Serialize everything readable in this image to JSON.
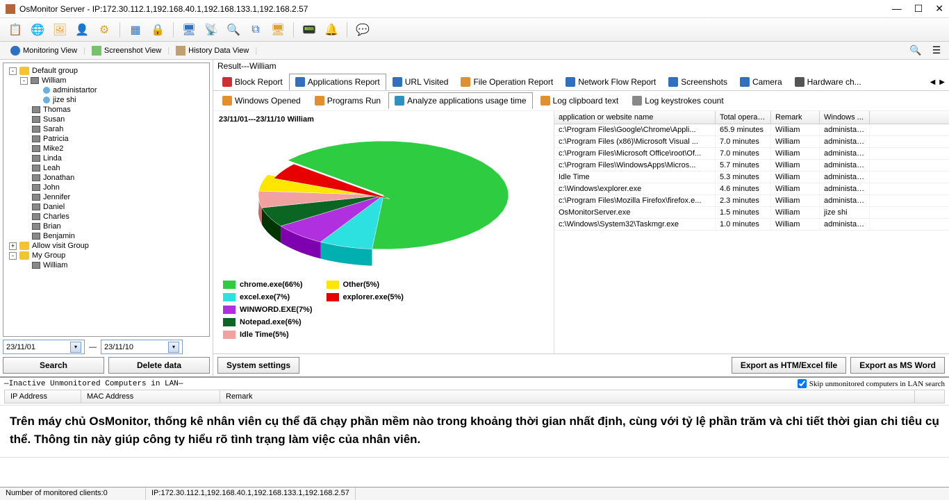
{
  "titlebar": {
    "text": "OsMonitor Server -   IP:172.30.112.1,192.168.40.1,192.168.133.1,192.168.2.57"
  },
  "viewbar": {
    "monitoring": "Monitoring View",
    "screenshot": "Screenshot View",
    "history": "History Data View"
  },
  "tree": {
    "default_group": "Default group",
    "items": [
      "William",
      "Thomas",
      "Susan",
      "Sarah",
      "Patricia",
      "Mike2",
      "Linda",
      "Leah",
      "Jonathan",
      "John",
      "Jennifer",
      "Daniel",
      "Charles",
      "Brian",
      "Benjamin"
    ],
    "william_children": [
      "administartor",
      "jize shi"
    ],
    "allow_group": "Allow visit Group",
    "my_group": "My Group",
    "my_group_children": [
      "William"
    ]
  },
  "dates": {
    "from": "23/11/01",
    "to": "23/11/10",
    "sep": "—"
  },
  "buttons": {
    "search": "Search",
    "delete": "Delete data",
    "system_settings": "System settings",
    "export_htm": "Export as HTM/Excel file",
    "export_word": "Export as MS Word"
  },
  "result_title": "Result---William",
  "report_tabs": [
    "Block Report",
    "Applications Report",
    "URL Visited",
    "File Operation Report",
    "Network Flow Report",
    "Screenshots",
    "Camera",
    "Hardware ch..."
  ],
  "sub_tabs": [
    "Windows Opened",
    "Programs Run",
    "Analyze applications usage time",
    "Log clipboard text",
    "Log keystrokes count"
  ],
  "chart_title": "23/11/01---23/11/10  William",
  "chart_data": {
    "type": "pie",
    "title": "23/11/01---23/11/10  William",
    "series": [
      {
        "name": "chrome.exe",
        "value": 66,
        "color": "#2ECC40"
      },
      {
        "name": "excel.exe",
        "value": 7,
        "color": "#2DE1E1"
      },
      {
        "name": "WINWORD.EXE",
        "value": 7,
        "color": "#B030E0"
      },
      {
        "name": "Notepad.exe",
        "value": 6,
        "color": "#0B6623"
      },
      {
        "name": "Idle Time",
        "value": 5,
        "color": "#F2A1A1"
      },
      {
        "name": "Other",
        "value": 5,
        "color": "#FFE600"
      },
      {
        "name": "explorer.exe",
        "value": 5,
        "color": "#E60000"
      }
    ]
  },
  "legend1": [
    {
      "label": "chrome.exe(66%)",
      "color": "#2ECC40"
    },
    {
      "label": "excel.exe(7%)",
      "color": "#2DE1E1"
    },
    {
      "label": "WINWORD.EXE(7%)",
      "color": "#B030E0"
    },
    {
      "label": "Notepad.exe(6%)",
      "color": "#0B6623"
    },
    {
      "label": "Idle Time(5%)",
      "color": "#F2A1A1"
    }
  ],
  "legend2": [
    {
      "label": "Other(5%)",
      "color": "#FFE600"
    },
    {
      "label": "explorer.exe(5%)",
      "color": "#E60000"
    }
  ],
  "table": {
    "headers": [
      "application or website name",
      "Total operati...",
      "Remark",
      "Windows ..."
    ],
    "rows": [
      [
        "c:\\Program Files\\Google\\Chrome\\Appli...",
        "65.9 minutes",
        "William",
        "administar..."
      ],
      [
        "c:\\Program Files (x86)\\Microsoft Visual ...",
        "7.0 minutes",
        "William",
        "administar..."
      ],
      [
        "c:\\Program Files\\Microsoft Office\\root\\Of...",
        "7.0 minutes",
        "William",
        "administar..."
      ],
      [
        "c:\\Program Files\\WindowsApps\\Micros...",
        "5.7 minutes",
        "William",
        "administar..."
      ],
      [
        "Idle Time",
        "5.3 minutes",
        "William",
        "administar..."
      ],
      [
        "c:\\Windows\\explorer.exe",
        "4.6 minutes",
        "William",
        "administar..."
      ],
      [
        "c:\\Program Files\\Mozilla Firefox\\firefox.e...",
        "2.3 minutes",
        "William",
        "administar..."
      ],
      [
        "OsMonitorServer.exe",
        "1.5 minutes",
        "William",
        "jize shi"
      ],
      [
        "c:\\Windows\\System32\\Taskmgr.exe",
        "1.0 minutes",
        "William",
        "administar..."
      ]
    ]
  },
  "lan": {
    "title": "Inactive Unmonitored Computers in LAN",
    "skip": "Skip unmonitored computers in LAN search",
    "headers": [
      "IP Address",
      "MAC Address",
      "Remark"
    ]
  },
  "overlay": "Trên máy chủ OsMonitor, thống kê nhân viên cụ thể đã chạy phần mềm nào trong khoảng thời gian nhất định, cùng với tỷ lệ phần trăm và chi tiết thời gian chi tiêu cụ thể. Thông tin này giúp công ty hiểu rõ tình trạng làm việc của nhân viên.",
  "status": {
    "clients": "Number of monitored clients:0",
    "ip": "IP:172.30.112.1,192.168.40.1,192.168.133.1,192.168.2.57"
  }
}
